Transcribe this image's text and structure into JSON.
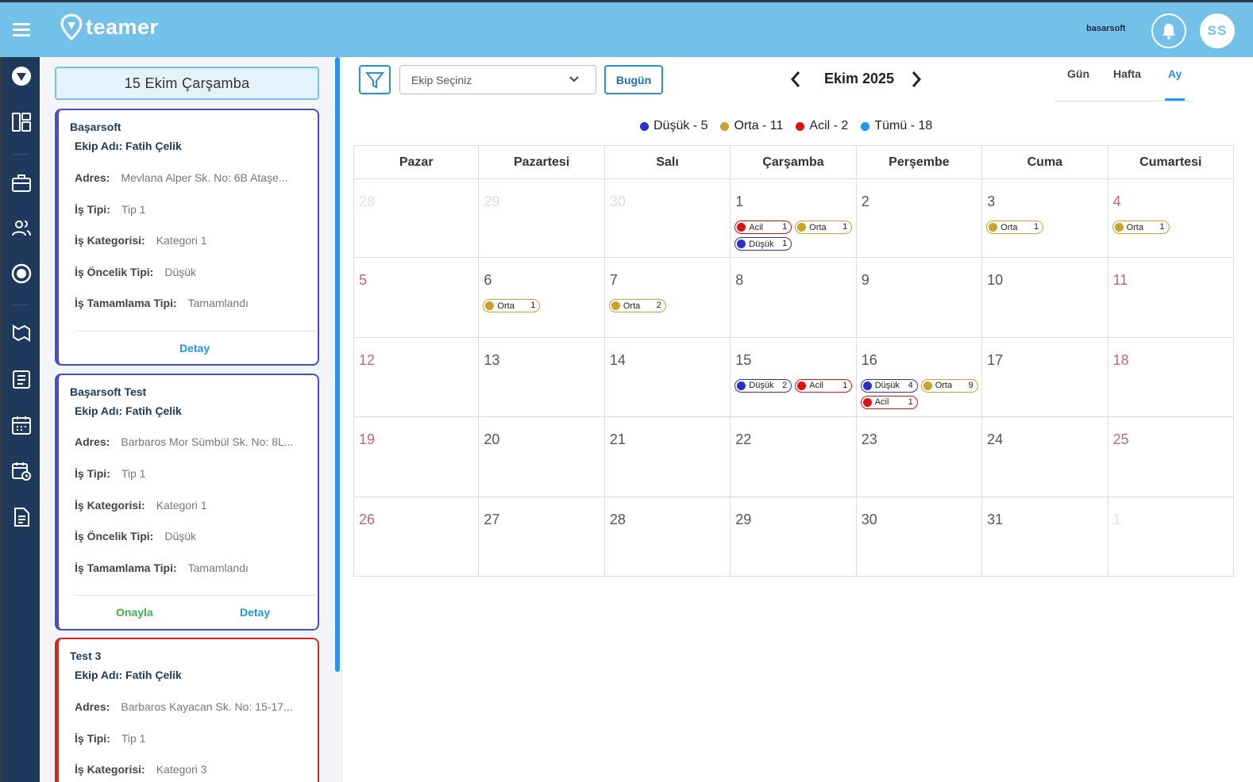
{
  "app": {
    "name": "teamer",
    "partner": "basarsoft",
    "user_initials": "SS"
  },
  "icons": {
    "menu": "hamburger-icon",
    "logo": "map-pin-logo-icon",
    "bell": "bell-icon",
    "rail": [
      "compass-icon",
      "dashboard-icon",
      "briefcase-icon",
      "users-icon",
      "record-icon",
      "map-icon",
      "clipboard-list-icon",
      "calendar-icon",
      "calendar-clock-icon",
      "document-icon"
    ]
  },
  "colors": {
    "topbar": "#73c1e8",
    "rail": "#1d3a5c",
    "low": "#2a2fcf",
    "medium": "#c9a32a",
    "urgent": "#e01010",
    "all": "#2196f3"
  },
  "left_panel": {
    "selected_date": "15 Ekim Çarşamba",
    "cards": [
      {
        "title": "Başarsoft",
        "team": "Ekip Adı: Fatih Çelik",
        "fields": [
          {
            "label": "Adres:",
            "value": "Mevlana Alper Sk. No: 6B Ataşe..."
          },
          {
            "label": "İş Tipi:",
            "value": "Tip 1"
          },
          {
            "label": "İş Kategorisi:",
            "value": "Kategori 1"
          },
          {
            "label": "İş Öncelik Tipi:",
            "value": "Düşük"
          },
          {
            "label": "İş Tamamlama Tipi:",
            "value": "Tamamlandı"
          }
        ],
        "detail_label": "Detay"
      },
      {
        "title": "Başarsoft Test",
        "team": "Ekip Adı: Fatih Çelik",
        "fields": [
          {
            "label": "Adres:",
            "value": "Barbaros Mor Sümbül Sk. No: 8L..."
          },
          {
            "label": "İş Tipi:",
            "value": "Tip 1"
          },
          {
            "label": "İş Kategorisi:",
            "value": "Kategori 1"
          },
          {
            "label": "İş Öncelik Tipi:",
            "value": "Düşük"
          },
          {
            "label": "İş Tamamlama Tipi:",
            "value": "Tamamlandı"
          }
        ],
        "approve_label": "Onayla",
        "detail_label": "Detay"
      },
      {
        "title": "Test 3",
        "team": "Ekip Adı: Fatih Çelik",
        "fields": [
          {
            "label": "Adres:",
            "value": "Barbaros Kayacan Sk. No: 15-17..."
          },
          {
            "label": "İş Tipi:",
            "value": "Tip 1"
          },
          {
            "label": "İş Kategorisi:",
            "value": "Kategori 3"
          }
        ]
      }
    ]
  },
  "toolbar": {
    "team_select_placeholder": "Ekip Seçiniz",
    "today_label": "Bugün",
    "month_title": "Ekim 2025",
    "views": [
      "Gün",
      "Hafta",
      "Ay"
    ],
    "active_view": "Ay"
  },
  "legend": [
    {
      "label": "Düşük - 5",
      "color": "#2a2fcf"
    },
    {
      "label": "Orta - 11",
      "color": "#c9a32a"
    },
    {
      "label": "Acil - 2",
      "color": "#e01010"
    },
    {
      "label": "Tümü - 18",
      "color": "#2196f3"
    }
  ],
  "calendar": {
    "weekdays": [
      "Pazar",
      "Pazartesi",
      "Salı",
      "Çarşamba",
      "Perşembe",
      "Cuma",
      "Cumartesi"
    ],
    "weeks": [
      [
        {
          "day": "28",
          "other": true,
          "weekend": true,
          "events": []
        },
        {
          "day": "29",
          "other": true,
          "events": []
        },
        {
          "day": "30",
          "other": true,
          "events": []
        },
        {
          "day": "1",
          "events": [
            {
              "type": "urgent",
              "label": "Acil",
              "count": "1"
            },
            {
              "type": "medium",
              "label": "Orta",
              "count": "1"
            },
            {
              "type": "low",
              "label": "Düşük",
              "count": "1"
            }
          ]
        },
        {
          "day": "2",
          "events": []
        },
        {
          "day": "3",
          "events": [
            {
              "type": "medium",
              "label": "Orta",
              "count": "1"
            }
          ]
        },
        {
          "day": "4",
          "weekend": true,
          "events": [
            {
              "type": "medium",
              "label": "Orta",
              "count": "1"
            }
          ]
        }
      ],
      [
        {
          "day": "5",
          "weekend": true,
          "events": []
        },
        {
          "day": "6",
          "events": [
            {
              "type": "medium",
              "label": "Orta",
              "count": "1"
            }
          ]
        },
        {
          "day": "7",
          "events": [
            {
              "type": "medium",
              "label": "Orta",
              "count": "2"
            }
          ]
        },
        {
          "day": "8",
          "events": []
        },
        {
          "day": "9",
          "events": []
        },
        {
          "day": "10",
          "events": []
        },
        {
          "day": "11",
          "weekend": true,
          "events": []
        }
      ],
      [
        {
          "day": "12",
          "weekend": true,
          "events": []
        },
        {
          "day": "13",
          "events": []
        },
        {
          "day": "14",
          "events": []
        },
        {
          "day": "15",
          "events": [
            {
              "type": "low",
              "label": "Düşük",
              "count": "2"
            },
            {
              "type": "urgent",
              "label": "Acil",
              "count": "1"
            }
          ]
        },
        {
          "day": "16",
          "events": [
            {
              "type": "low",
              "label": "Düşük",
              "count": "4"
            },
            {
              "type": "medium",
              "label": "Orta",
              "count": "9"
            },
            {
              "type": "urgent",
              "label": "Acil",
              "count": "1"
            }
          ]
        },
        {
          "day": "17",
          "events": []
        },
        {
          "day": "18",
          "weekend": true,
          "events": []
        }
      ],
      [
        {
          "day": "19",
          "weekend": true,
          "events": []
        },
        {
          "day": "20",
          "events": []
        },
        {
          "day": "21",
          "events": []
        },
        {
          "day": "22",
          "events": []
        },
        {
          "day": "23",
          "events": []
        },
        {
          "day": "24",
          "events": []
        },
        {
          "day": "25",
          "weekend": true,
          "events": []
        }
      ],
      [
        {
          "day": "26",
          "weekend": true,
          "events": []
        },
        {
          "day": "27",
          "events": []
        },
        {
          "day": "28",
          "events": []
        },
        {
          "day": "29",
          "events": []
        },
        {
          "day": "30",
          "events": []
        },
        {
          "day": "31",
          "events": []
        },
        {
          "day": "1",
          "other": true,
          "weekend": true,
          "events": []
        }
      ]
    ]
  }
}
